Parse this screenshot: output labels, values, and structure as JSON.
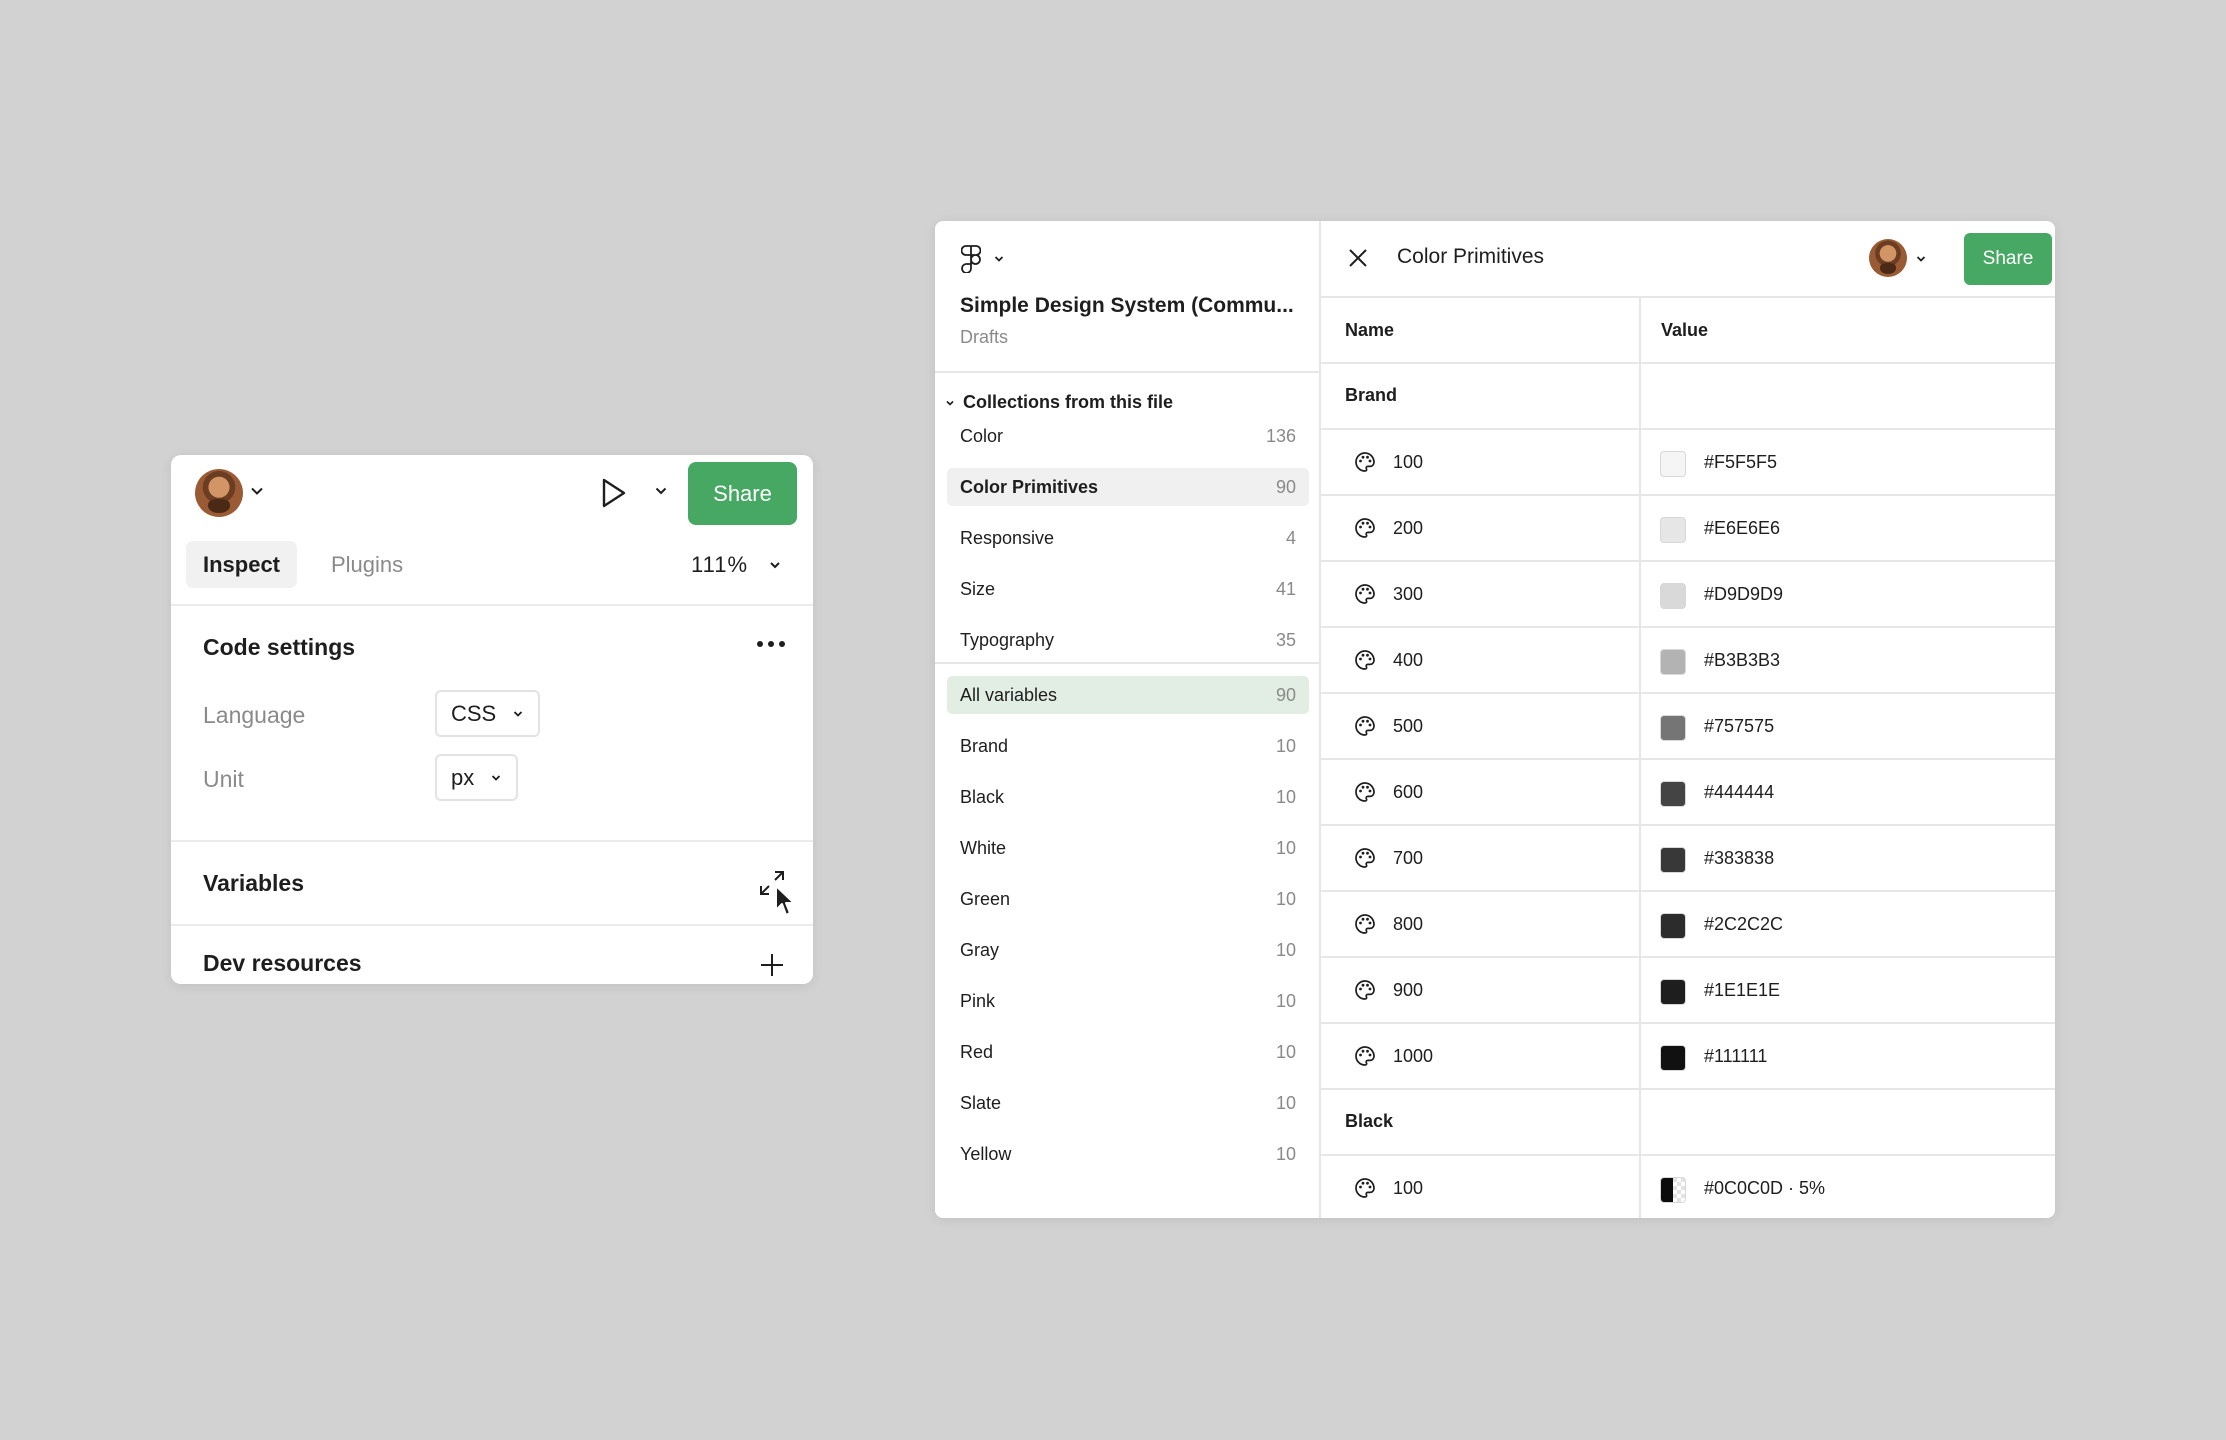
{
  "inspect_panel": {
    "share_label": "Share",
    "tabs": [
      {
        "label": "Inspect"
      },
      {
        "label": "Plugins"
      }
    ],
    "zoom": "111%",
    "code_settings": {
      "title": "Code settings",
      "language_label": "Language",
      "language_value": "CSS",
      "unit_label": "Unit",
      "unit_value": "px"
    },
    "variables_title": "Variables",
    "dev_resources_title": "Dev resources"
  },
  "variables_window": {
    "file_name": "Simple Design System (Commu...",
    "file_location": "Drafts",
    "collections_header": "Collections from this file",
    "collections": [
      {
        "name": "Color",
        "count": "136"
      },
      {
        "name": "Color Primitives",
        "count": "90",
        "selected": true
      },
      {
        "name": "Responsive",
        "count": "4"
      },
      {
        "name": "Size",
        "count": "41"
      },
      {
        "name": "Typography",
        "count": "35"
      }
    ],
    "groups": [
      {
        "name": "All variables",
        "count": "90",
        "selected": true
      },
      {
        "name": "Brand",
        "count": "10"
      },
      {
        "name": "Black",
        "count": "10"
      },
      {
        "name": "White",
        "count": "10"
      },
      {
        "name": "Green",
        "count": "10"
      },
      {
        "name": "Gray",
        "count": "10"
      },
      {
        "name": "Pink",
        "count": "10"
      },
      {
        "name": "Red",
        "count": "10"
      },
      {
        "name": "Slate",
        "count": "10"
      },
      {
        "name": "Yellow",
        "count": "10"
      }
    ],
    "collection_title": "Color Primitives",
    "share_label": "Share",
    "table_headers": {
      "name": "Name",
      "value": "Value"
    },
    "table_groups": [
      {
        "name": "Brand",
        "rows": [
          {
            "name": "100",
            "value": "#F5F5F5",
            "color": "#F5F5F5"
          },
          {
            "name": "200",
            "value": "#E6E6E6",
            "color": "#E6E6E6"
          },
          {
            "name": "300",
            "value": "#D9D9D9",
            "color": "#D9D9D9"
          },
          {
            "name": "400",
            "value": "#B3B3B3",
            "color": "#B3B3B3"
          },
          {
            "name": "500",
            "value": "#757575",
            "color": "#757575"
          },
          {
            "name": "600",
            "value": "#444444",
            "color": "#444444"
          },
          {
            "name": "700",
            "value": "#383838",
            "color": "#383838"
          },
          {
            "name": "800",
            "value": "#2C2C2C",
            "color": "#2C2C2C"
          },
          {
            "name": "900",
            "value": "#1E1E1E",
            "color": "#1E1E1E"
          },
          {
            "name": "1000",
            "value": "#111111",
            "color": "#111111"
          }
        ]
      },
      {
        "name": "Black",
        "rows": [
          {
            "name": "100",
            "value": "#0C0C0D · 5%",
            "color": "#0C0C0D",
            "alpha": true
          }
        ]
      }
    ],
    "help_label": "?"
  },
  "colors": {
    "share_green": "#47A863",
    "selected_group_bg": "#E2EEE4",
    "selected_collection_bg": "#F0F0F0"
  }
}
